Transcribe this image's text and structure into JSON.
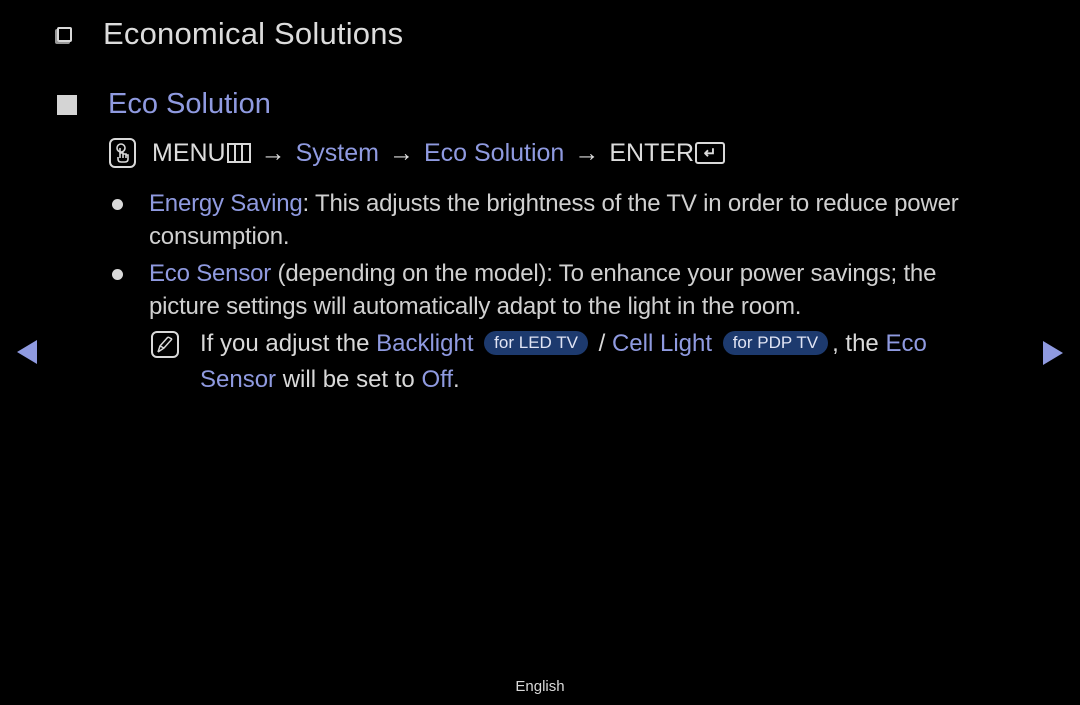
{
  "section": {
    "icon": "box-outline-icon",
    "title": "Economical Solutions"
  },
  "subsection": {
    "icon": "box-filled-icon",
    "title": "Eco Solution"
  },
  "menu_path": {
    "remote_icon": "remote-hand-icon",
    "menu": "MENU",
    "menu_icon": "menu-icon",
    "arrow": "→",
    "system": "System",
    "eco_solution": "Eco Solution",
    "enter": "ENTER",
    "enter_icon": "enter-icon"
  },
  "bullets": [
    {
      "term": "Energy Saving",
      "text": ": This adjusts the brightness of the TV in order to reduce power consumption."
    },
    {
      "term": "Eco Sensor",
      "text": " (depending on the model): To enhance your power savings; the picture settings will automatically adapt to the light in the room."
    }
  ],
  "note": {
    "icon": "note-pencil-icon",
    "part1": "If you adjust the ",
    "backlight": "Backlight",
    "badge_led": "for LED TV",
    "slash": " / ",
    "cell_light": "Cell Light",
    "badge_pdp": "for PDP TV",
    "part2": ", the ",
    "eco_sensor": "Eco Sensor",
    "part3": " will be set to ",
    "off": "Off",
    "part4": "."
  },
  "navigation": {
    "prev": "previous-page",
    "next": "next-page"
  },
  "footer": {
    "language": "English"
  },
  "colors": {
    "background": "#000000",
    "highlight": "#8f9ae0",
    "text": "#d9d9d9",
    "badge": "#1d3a6e"
  }
}
